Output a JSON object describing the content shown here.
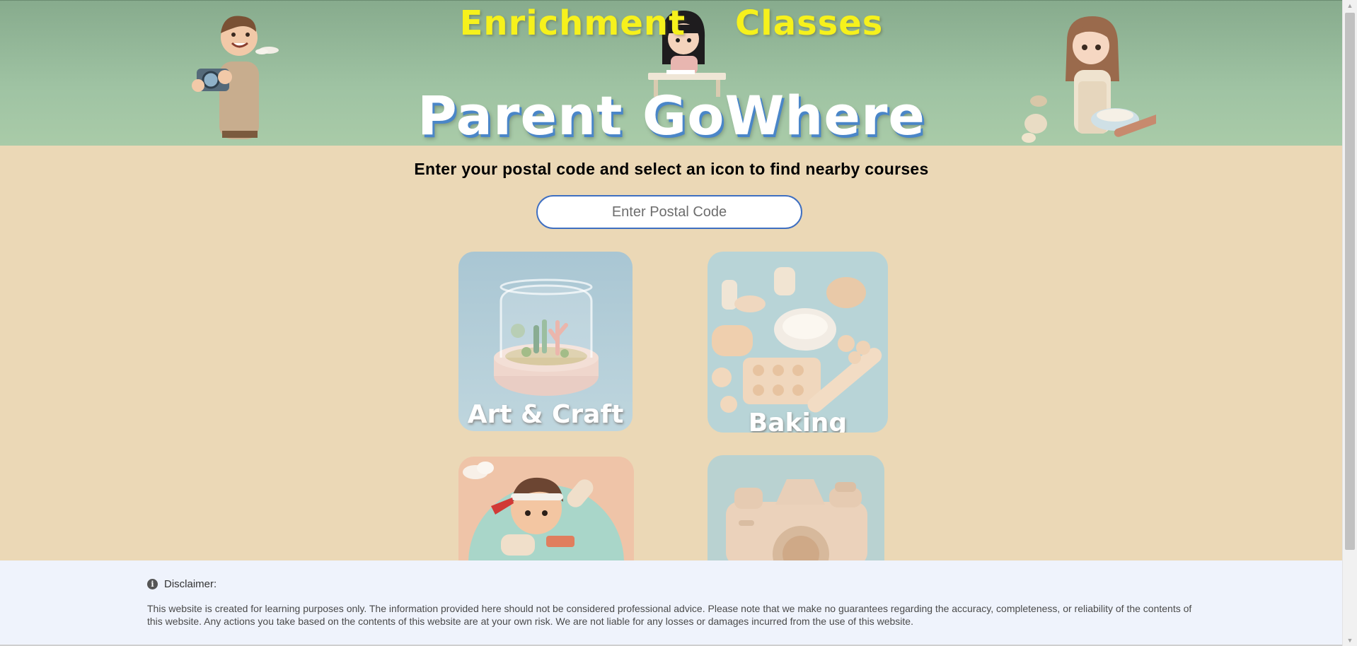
{
  "header": {
    "title_left": "Enrichment",
    "title_right": "Classes",
    "site_name": "Parent GoWhere"
  },
  "main": {
    "instruction": "Enter your postal code and select an icon to find nearby courses",
    "postal_input": {
      "placeholder": "Enter Postal Code",
      "value": ""
    },
    "categories": [
      {
        "label": "Art & Craft",
        "icon": "terrarium-icon"
      },
      {
        "label": "Baking",
        "icon": "baking-icon"
      },
      {
        "label": "",
        "icon": "martial-arts-icon"
      },
      {
        "label": "",
        "icon": "camera-icon"
      }
    ]
  },
  "disclaimer": {
    "heading": "Disclaimer:",
    "text": "This website is created for learning purposes only. The information provided here should not be considered professional advice. Please note that we make no guarantees regarding the accuracy, completeness, or reliability of the contents of this website. Any actions you take based on the contents of this website are at your own risk. We are not liable for any losses or damages incurred from the use of this website."
  },
  "colors": {
    "banner_green": "#9fc3a3",
    "title_yellow": "#f6f11c",
    "page_beige": "#ebd8b6",
    "input_border": "#3f6fc1",
    "disclaimer_bg": "#eff3fc"
  }
}
